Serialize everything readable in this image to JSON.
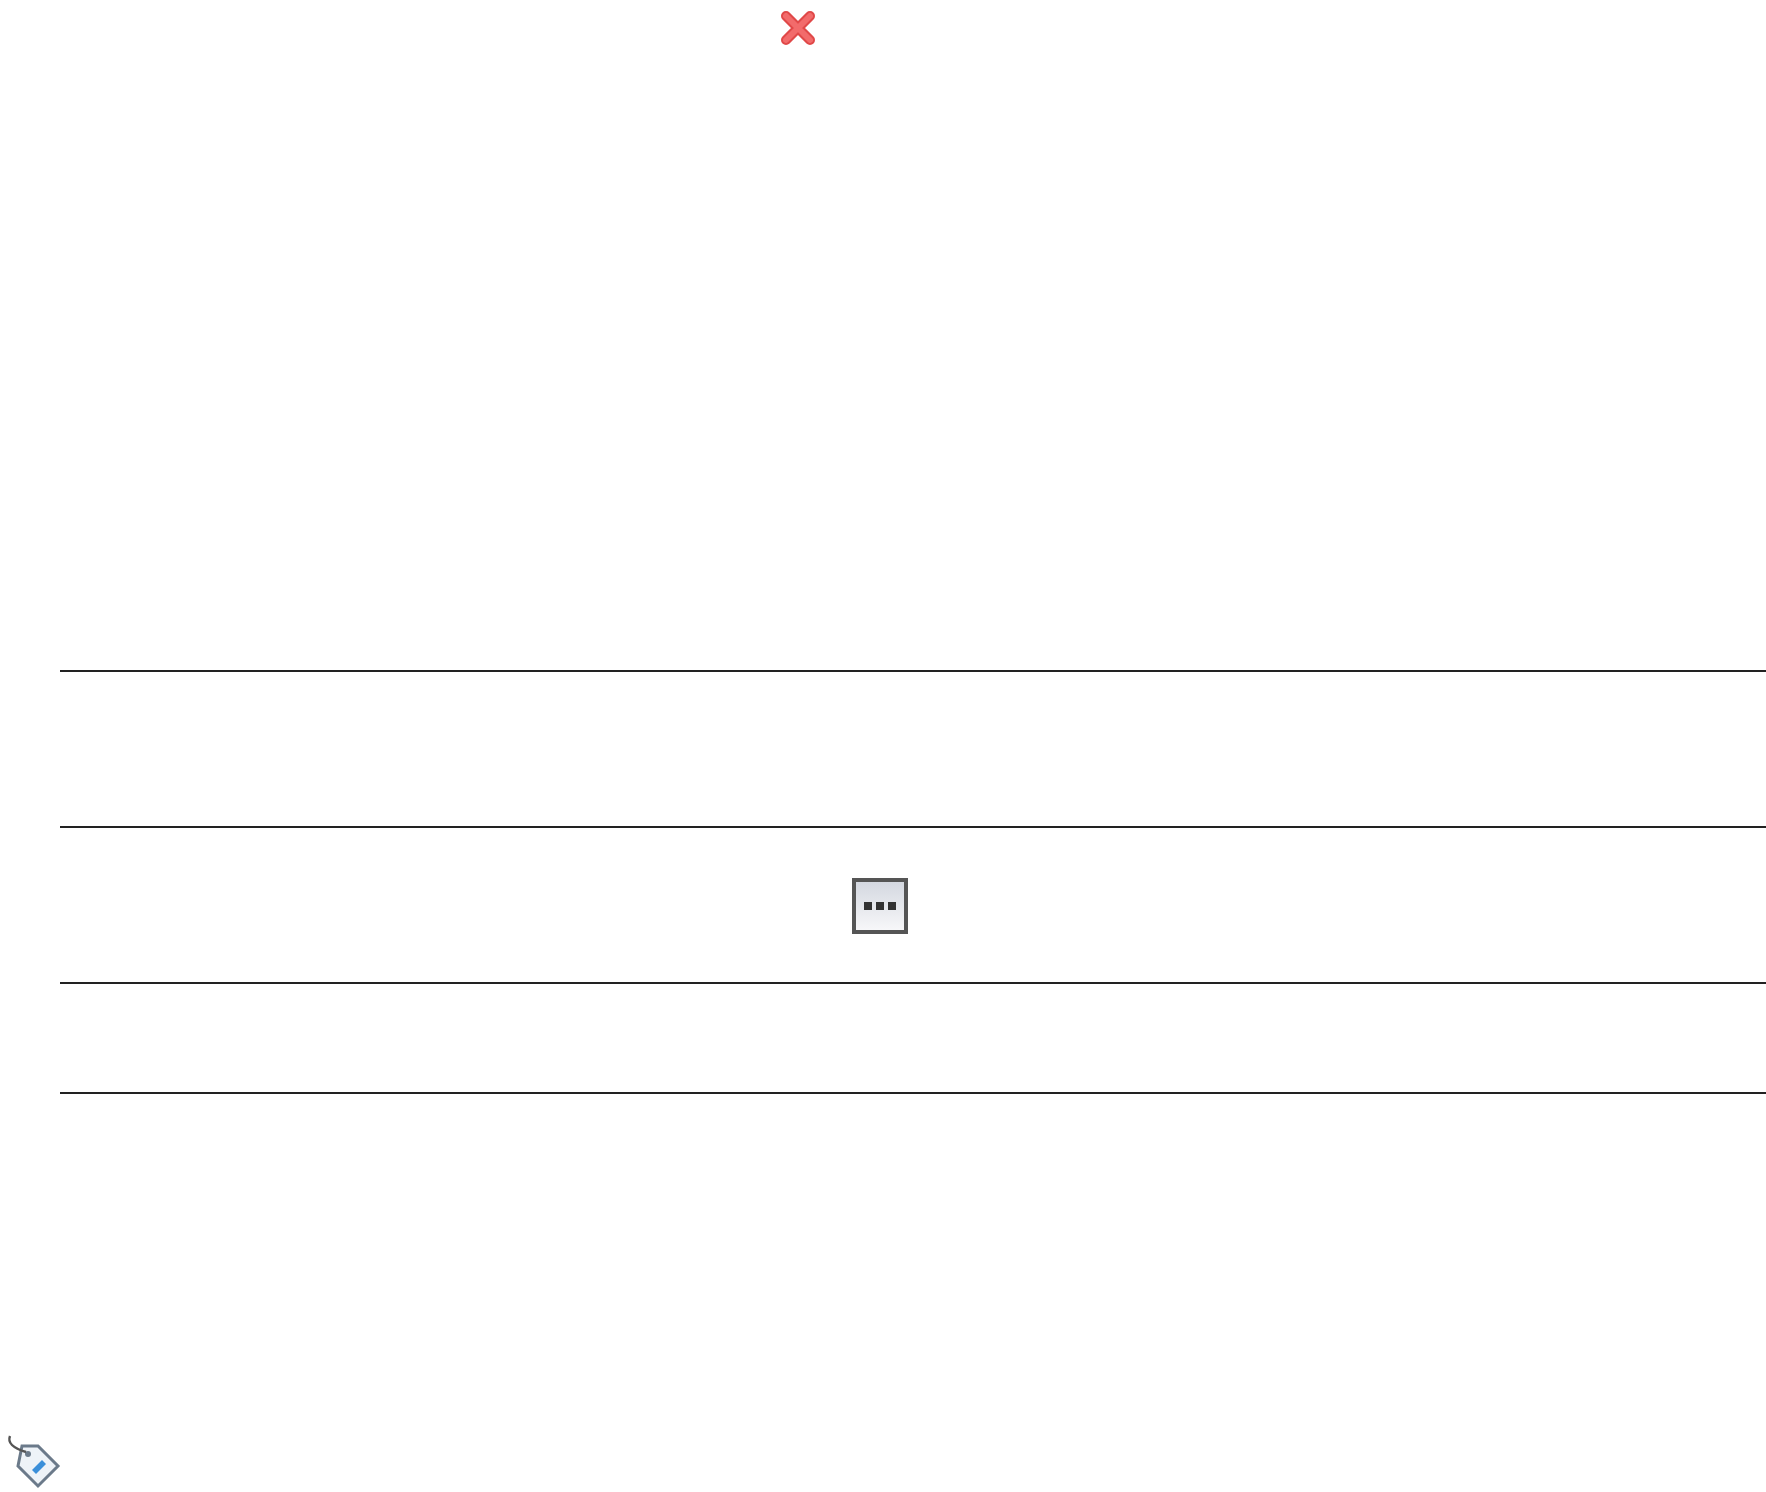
{
  "rows": [
    {
      "kind": "empty"
    },
    {
      "kind": "ellipsis_button"
    },
    {
      "kind": "empty"
    }
  ]
}
